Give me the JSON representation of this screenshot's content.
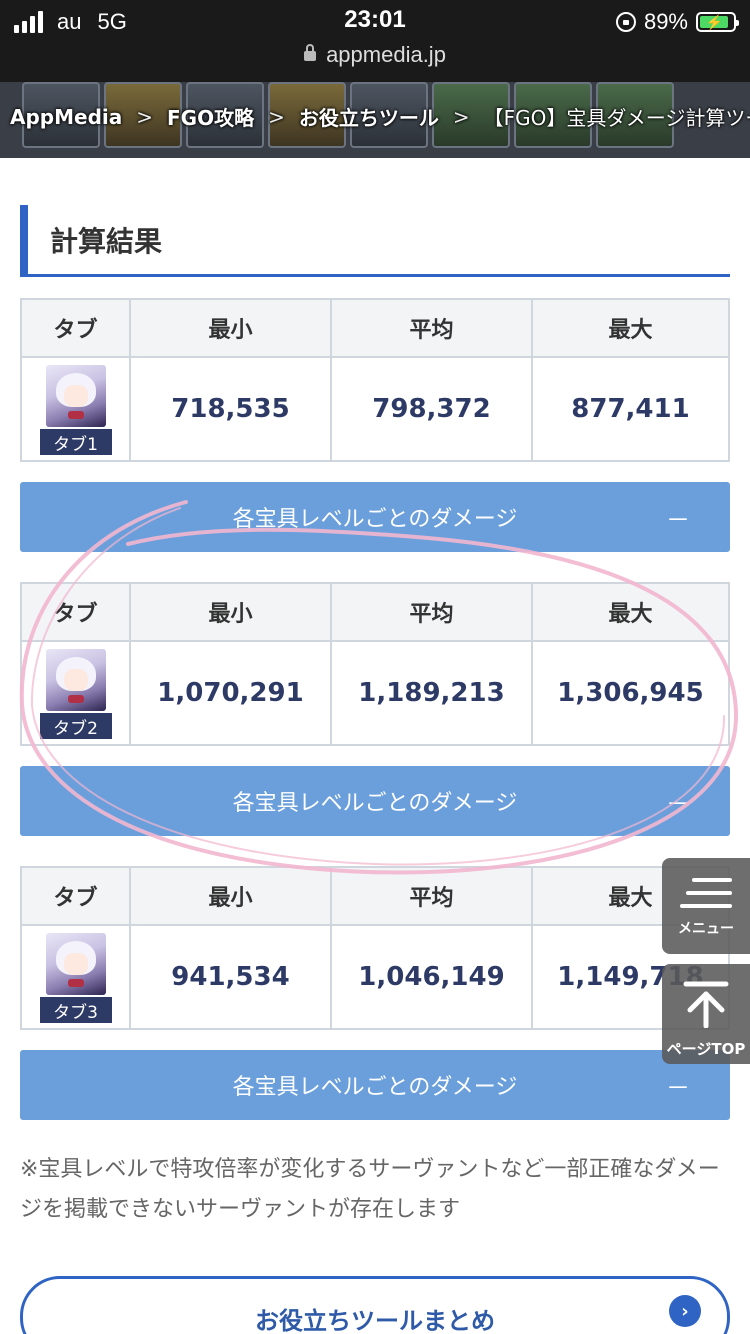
{
  "status_bar": {
    "carrier": "au",
    "network": "5G",
    "time": "23:01",
    "battery_percent": "89%",
    "url": "appmedia.jp"
  },
  "breadcrumb": {
    "items": [
      "AppMedia",
      "FGO攻略",
      "お役立ちツール",
      "【FGO】宝具ダメージ計算ツール"
    ]
  },
  "section_title": "計算結果",
  "table_headers": [
    "タブ",
    "最小",
    "平均",
    "最大"
  ],
  "results": [
    {
      "tab_label": "タブ1",
      "min": "718,535",
      "avg": "798,372",
      "max": "877,411"
    },
    {
      "tab_label": "タブ2",
      "min": "1,070,291",
      "avg": "1,189,213",
      "max": "1,306,945"
    },
    {
      "tab_label": "タブ3",
      "min": "941,534",
      "avg": "1,046,149",
      "max": "1,149,718"
    }
  ],
  "damage_toggle_label": "各宝具レベルごとのダメージ",
  "damage_toggle_symbol": "－",
  "note": "※宝具レベルで特攻倍率が変化するサーヴァントなど一部正確なダメージを掲載できないサーヴァントが存在します",
  "summary_button": "お役立ちツールまとめ",
  "floating": {
    "menu_label": "メニュー",
    "top_label": "ページTOP"
  },
  "colors": {
    "accent": "#2f63c4",
    "toggle_bar": "#6a9fdc",
    "value_text": "#2e3a66",
    "highlight_ellipse": "#f2b6cf"
  }
}
